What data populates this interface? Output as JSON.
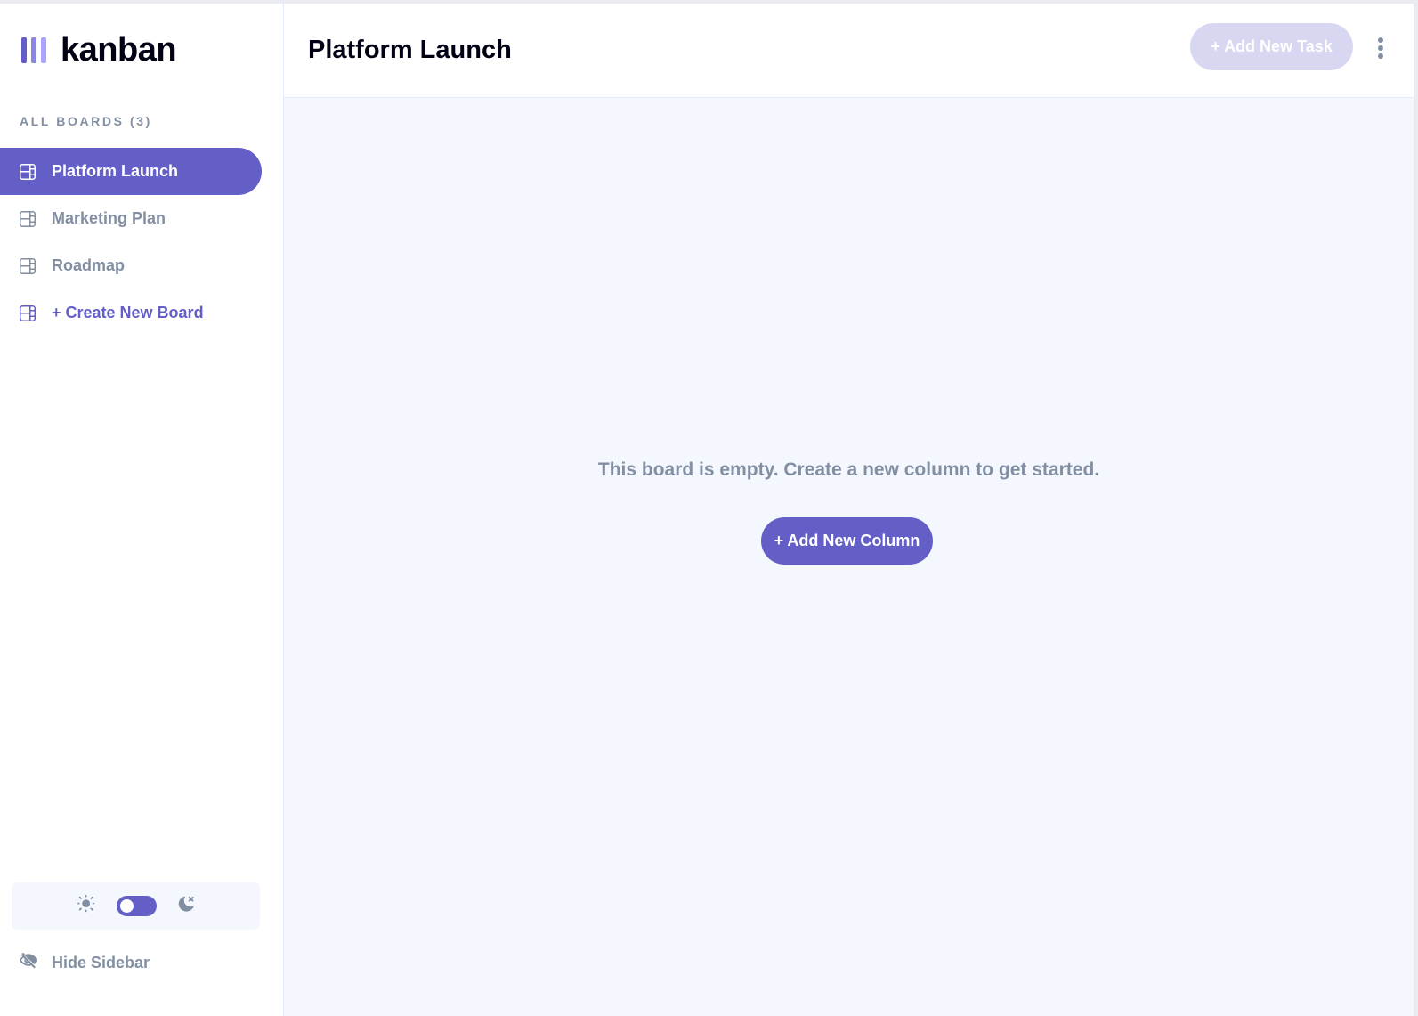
{
  "app": {
    "logo_text": "kanban",
    "logo_bar_colors": [
      "#635fc7",
      "#8b87e0",
      "#a8a4ff"
    ]
  },
  "colors": {
    "accent": "#635fc7",
    "accent_light": "#d8d7f1",
    "muted_text": "#828fa3",
    "dark_text": "#000112",
    "board_bg": "#f4f7fd"
  },
  "sidebar": {
    "heading": "ALL BOARDS (3)",
    "boards": [
      {
        "label": "Platform Launch",
        "icon": "board-icon",
        "active": true
      },
      {
        "label": "Marketing Plan",
        "icon": "board-icon",
        "active": false
      },
      {
        "label": "Roadmap",
        "icon": "board-icon",
        "active": false
      }
    ],
    "create_label": "+ Create New Board",
    "theme": {
      "light_icon": "sun-icon",
      "dark_icon": "moon-icon",
      "mode": "light"
    },
    "hide_label": "Hide Sidebar",
    "hide_icon": "eye-slash-icon"
  },
  "header": {
    "title": "Platform Launch",
    "add_task_label": "+ Add New Task",
    "menu_icon": "kebab-menu-icon"
  },
  "board": {
    "empty_message": "This board is empty. Create a new column to get started.",
    "add_column_label": "+ Add New Column"
  }
}
